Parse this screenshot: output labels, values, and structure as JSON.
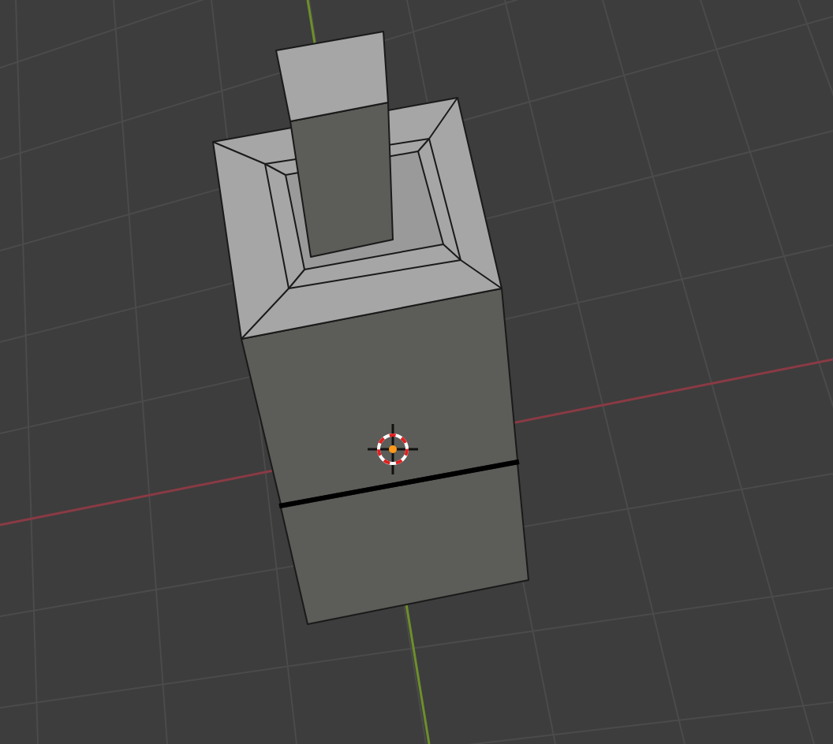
{
  "viewport": {
    "kind": "perspective",
    "object": {
      "kind": "mesh"
    }
  }
}
